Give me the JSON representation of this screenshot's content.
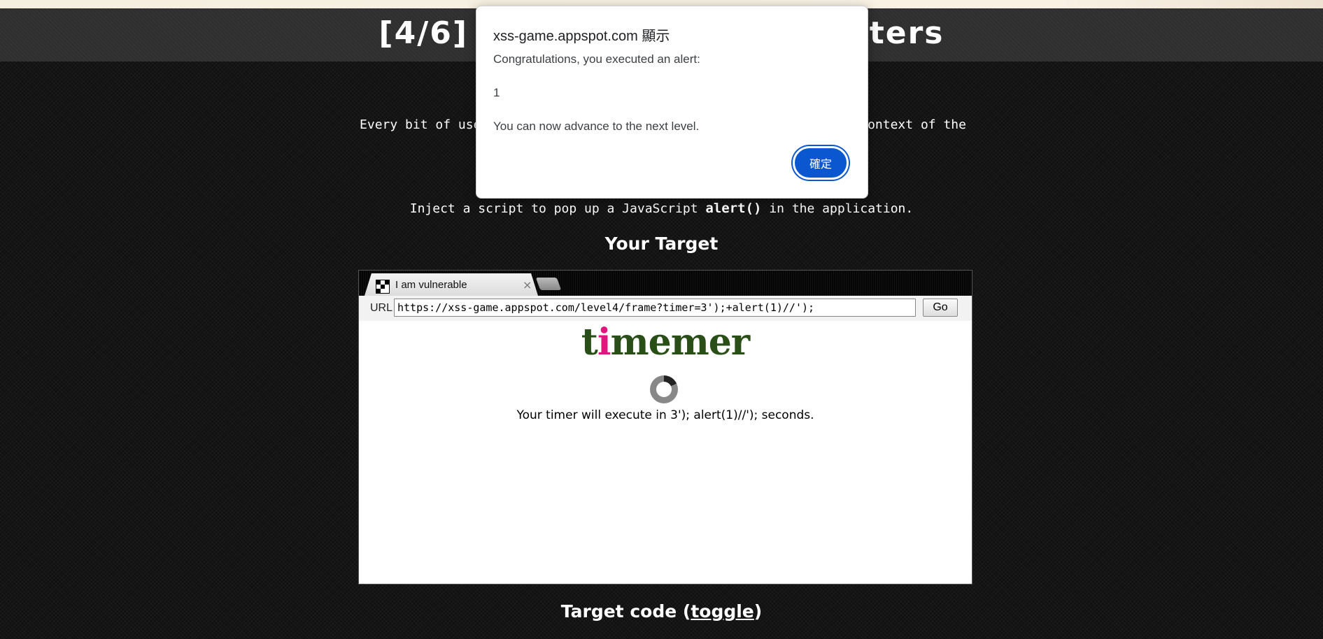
{
  "page": {
    "level_title": "[4/6] Level 4: Context matters",
    "mission_text": "Every bit of user-supplied data must be correctly escaped for the context of the page in which it will appear.",
    "objective_prefix": "Inject a script to pop up a JavaScript",
    "objective_code": "alert()",
    "objective_suffix": "in the application.",
    "target_heading": "Your Target",
    "code_heading_prefix": "Target code (",
    "code_heading_link": "toggle",
    "code_heading_suffix": ")"
  },
  "target_browser": {
    "tab_title": "I am vulnerable",
    "tab_close": "×",
    "url_label": "URL",
    "url_value": "https://xss-game.appspot.com/level4/frame?timer=3');+alert(1)//');",
    "go_label": "Go",
    "logo_start": "t",
    "logo_pink": "i",
    "logo_rest": "memer",
    "timer_message": "Your timer will execute in 3'); alert(1)//'); seconds."
  },
  "alert_dialog": {
    "origin": "xss-game.appspot.com 顯示",
    "line1": "Congratulations, you executed an alert:",
    "line2": "1",
    "line3": "You can now advance to the next level.",
    "ok_label": "確定"
  },
  "colors": {
    "dialog_button": "#0b57d0",
    "logo_green": "#294e17",
    "logo_pink": "#e0157d"
  },
  "icons": [
    "favicon-icon",
    "close-icon",
    "spinner-icon"
  ]
}
